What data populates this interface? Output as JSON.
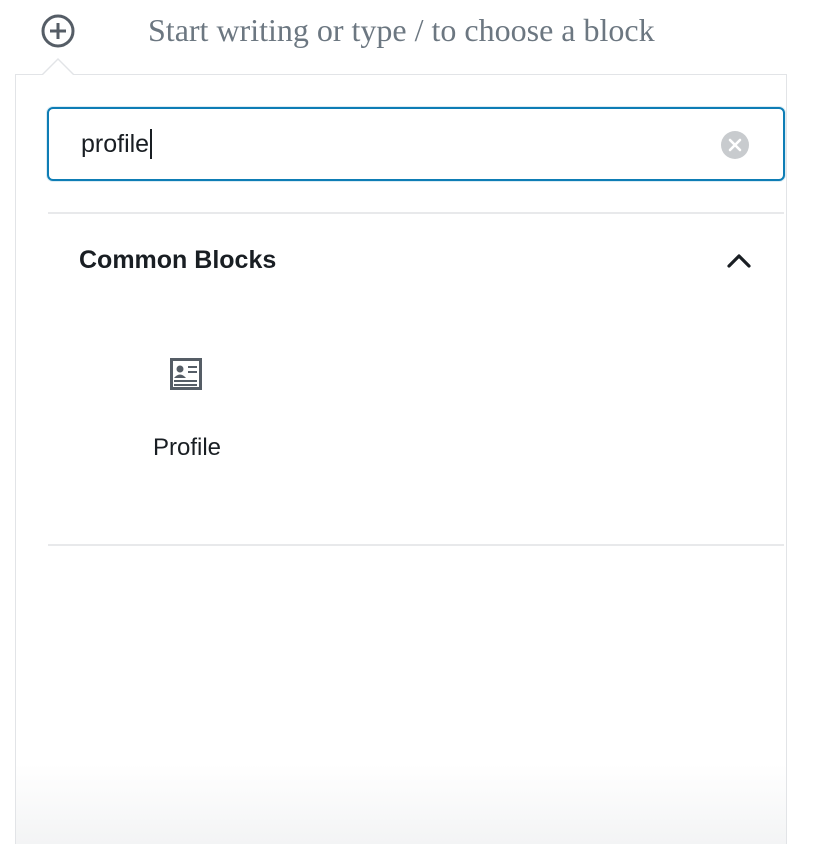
{
  "editor": {
    "placeholder": "Start writing or type / to choose a block",
    "add_block_icon": "plus-circle-icon"
  },
  "inserter": {
    "search": {
      "value": "profile",
      "clear_icon": "clear-circle-icon"
    },
    "panel": {
      "title": "Common Blocks",
      "toggle_icon": "chevron-up-icon",
      "expanded": true,
      "blocks": [
        {
          "label": "Profile",
          "icon": "profile-card-icon"
        }
      ]
    }
  },
  "colors": {
    "accent": "#0e7db5",
    "text": "#191e23",
    "muted": "#6c7781",
    "icon": "#555d66"
  }
}
